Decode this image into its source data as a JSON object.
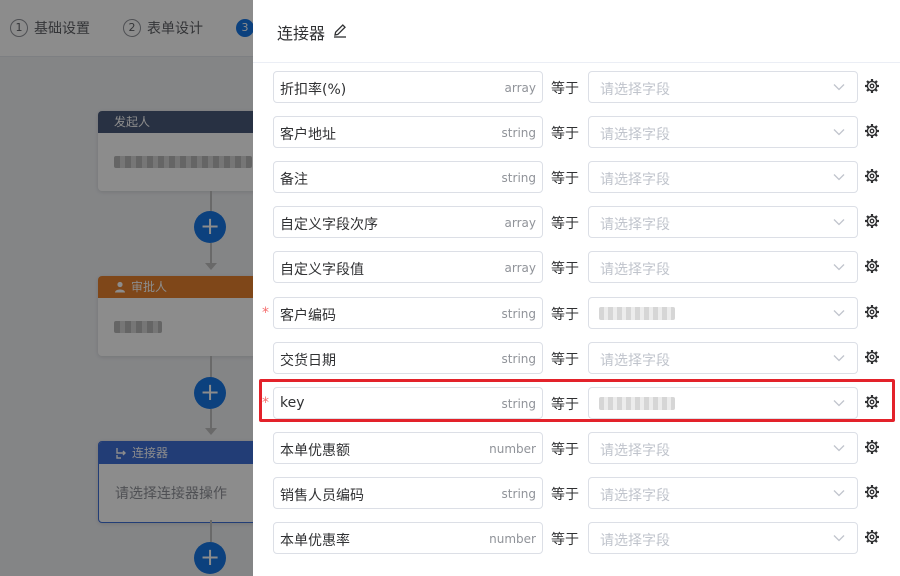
{
  "steps": [
    {
      "num": "1",
      "label": "基础设置"
    },
    {
      "num": "2",
      "label": "表单设计"
    },
    {
      "num": "3",
      "label": ""
    }
  ],
  "flow": {
    "initiator": {
      "title": "发起人"
    },
    "approver": {
      "title": "审批人"
    },
    "connector": {
      "title": "连接器",
      "body": "请选择连接器操作"
    },
    "add_symbol": "+"
  },
  "drawer": {
    "title": "连接器",
    "operator": "等于",
    "placeholder": "请选择字段",
    "rows": [
      {
        "name": "折扣率(%)",
        "type": "array",
        "required": "",
        "value": ""
      },
      {
        "name": "客户地址",
        "type": "string",
        "required": "",
        "value": ""
      },
      {
        "name": "备注",
        "type": "string",
        "required": "",
        "value": ""
      },
      {
        "name": "自定义字段次序",
        "type": "array",
        "required": "",
        "value": ""
      },
      {
        "name": "自定义字段值",
        "type": "array",
        "required": "",
        "value": ""
      },
      {
        "name": "客户编码",
        "type": "string",
        "required": "*",
        "value": "blurred"
      },
      {
        "name": "交货日期",
        "type": "string",
        "required": "",
        "value": ""
      },
      {
        "name": "key",
        "type": "string",
        "required": "*",
        "value": "blurred"
      },
      {
        "name": "本单优惠额",
        "type": "number",
        "required": "",
        "value": ""
      },
      {
        "name": "销售人员编码",
        "type": "string",
        "required": "",
        "value": ""
      },
      {
        "name": "本单优惠率",
        "type": "number",
        "required": "",
        "value": ""
      }
    ]
  },
  "colors": {
    "initiator_header": "#4a5a7a",
    "approver_header": "#e7822e",
    "connector_header": "#3f6fd8",
    "primary": "#1677e6",
    "highlight": "#e3222a",
    "required": "#f56c6c"
  },
  "icons": {
    "edit": "edit-icon",
    "gear": "gear-icon",
    "chevron": "chevron-down-icon",
    "user": "user-icon",
    "connector": "connector-icon"
  }
}
